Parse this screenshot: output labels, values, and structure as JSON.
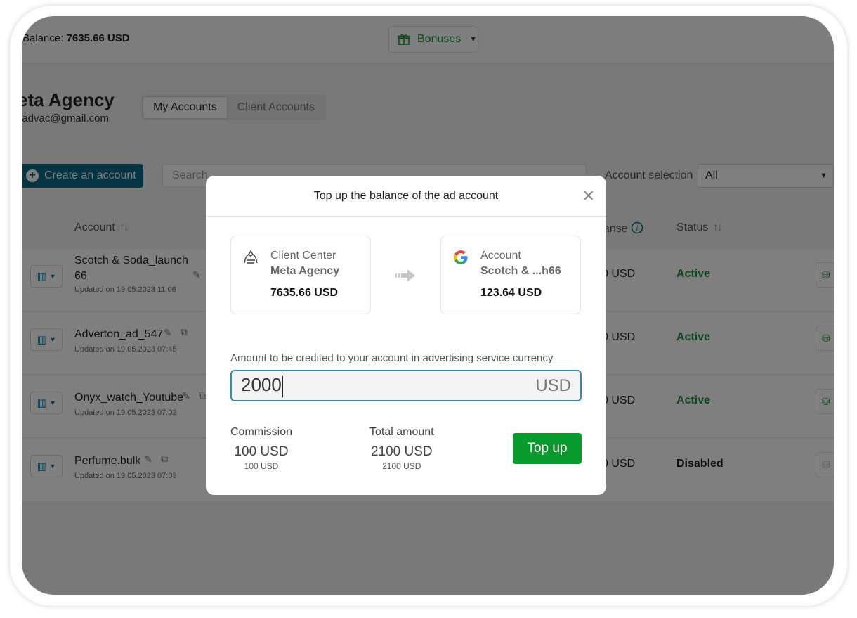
{
  "header": {
    "balance_label": "Balance:",
    "balance_value": "7635.66 USD",
    "bonuses_label": "Bonuses"
  },
  "agency": {
    "name": "eta Agency",
    "email": "oadvac@gmail.com"
  },
  "tabs": [
    {
      "label": "My Accounts",
      "active": true
    },
    {
      "label": "Client Accounts",
      "active": false
    }
  ],
  "toolbar": {
    "create_label": "Create an account",
    "search_placeholder": "Search",
    "account_selection_label": "Account selection",
    "account_selection_value": "All"
  },
  "table": {
    "col_account": "Account",
    "col_spend_partial": "anse",
    "col_status": "Status",
    "rows": [
      {
        "name": "Scotch & Soda_launch 66",
        "name_line1": "Scotch & Soda_launch",
        "name_line2": "66",
        "updated": "Updated on 19.05.2023 11:06",
        "spend": "0 USD",
        "status": "Active"
      },
      {
        "name": "Adverton_ad_547",
        "updated": "Updated on 19.05.2023 07:45",
        "spend": "0 USD",
        "status": "Active"
      },
      {
        "name": "Onyx_watch_Youtube",
        "updated": "Updated on 19.05.2023 07:02",
        "spend": "0 USD",
        "status": "Active"
      },
      {
        "name": "Perfume.bulk",
        "updated": "Updated on 19.05.2023 07:03",
        "spend": "0 USD",
        "status": "Disabled"
      }
    ]
  },
  "modal": {
    "title": "Top up the balance of the ad account",
    "from": {
      "label": "Client Center",
      "name": "Meta Agency",
      "amount": "7635.66 USD"
    },
    "to": {
      "label": "Account",
      "name": "Scotch & ...h66",
      "amount": "123.64 USD"
    },
    "amount_label": "Amount to be credited to your account in advertising service currency",
    "amount_value": "2000",
    "amount_currency": "USD",
    "commission_label": "Commission",
    "commission_value": "100 USD",
    "commission_sub": "100 USD",
    "total_label": "Total amount",
    "total_value": "2100 USD",
    "total_sub": "2100 USD",
    "topup_label": "Top up"
  },
  "colors": {
    "accent": "#0b6a8a",
    "success": "#099a2e",
    "active_status": "#1e8e3e"
  }
}
